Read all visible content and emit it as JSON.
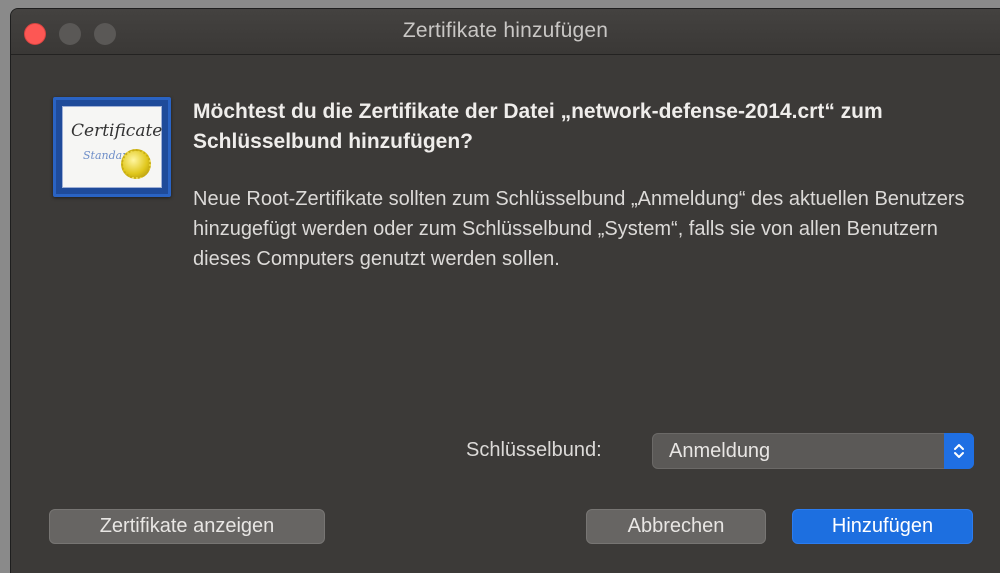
{
  "window": {
    "title": "Zertifikate hinzufügen"
  },
  "icon": {
    "certificate_title": "Certificate",
    "certificate_subtitle": "Standard"
  },
  "dialog": {
    "heading": "Möchtest du die Zertifikate der Datei „network-defense-2014.crt“ zum Schlüsselbund hinzufügen?",
    "body": "Neue Root-Zertifikate sollten zum Schlüsselbund „Anmeldung“ des aktuellen Benutzers hinzugefügt werden oder zum Schlüsselbund „System“, falls sie von allen Benutzern dieses Computers genutzt werden sollen."
  },
  "keychain": {
    "label": "Schlüsselbund:",
    "selected": "Anmeldung"
  },
  "buttons": {
    "show_certificates": "Zertifikate anzeigen",
    "cancel": "Abbrechen",
    "add": "Hinzufügen"
  },
  "colors": {
    "close_button": "#fd5754",
    "accent": "#1d6fe0",
    "background": "#3c3a38"
  }
}
